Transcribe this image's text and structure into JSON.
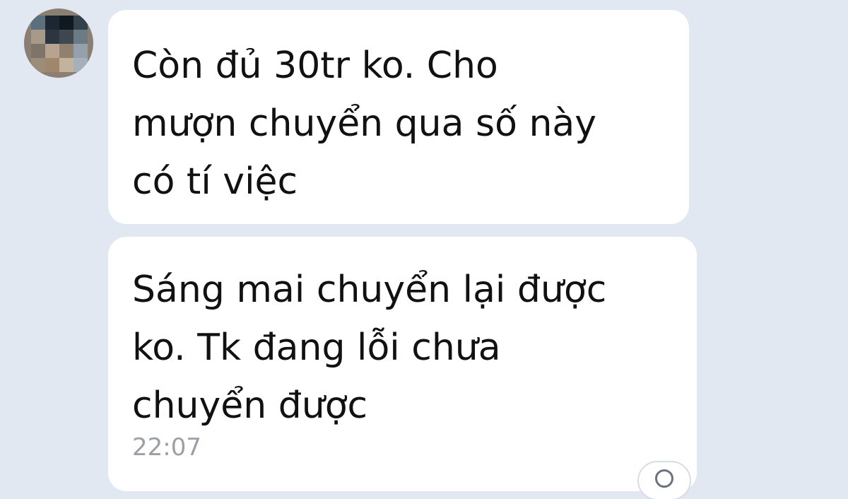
{
  "chat": {
    "messages": [
      {
        "text": "Còn đủ 30tr ko. Cho\nmượn chuyển qua số này\ncó tí việc",
        "time": ""
      },
      {
        "text": "Sáng mai chuyển lại được\nko. Tk đang lỗi chưa\nchuyển được",
        "time": "22:07"
      }
    ]
  },
  "colors": {
    "background": "#e2e8f1",
    "bubble": "#ffffff",
    "text": "#111111",
    "timestamp": "#9aa0a6"
  },
  "icons": {
    "reaction": "emoji-reaction-icon"
  }
}
